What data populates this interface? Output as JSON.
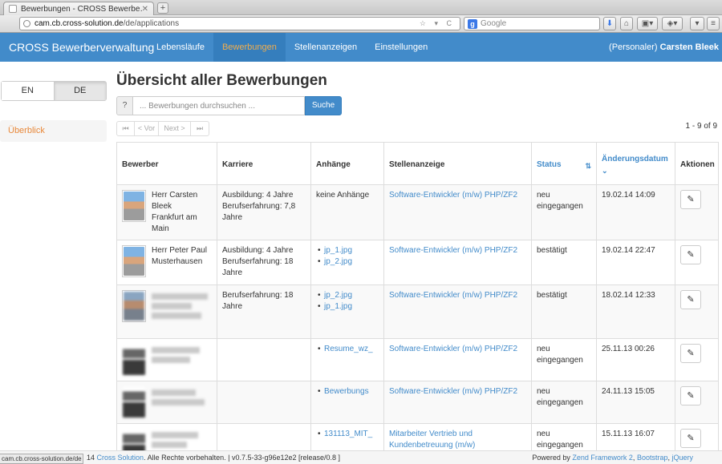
{
  "browser": {
    "tab_title": "Bewerbungen - CROSS Bewerbe…",
    "url_host": "cam.cb.cross-solution.de",
    "url_path": "/de/applications",
    "search_placeholder": "Google",
    "status_url": "cam.cb.cross-solution.de/de"
  },
  "app": {
    "brand": "CROSS Bewerberverwaltung",
    "nav": [
      "Lebensläufe",
      "Bewerbungen",
      "Stellenanzeigen",
      "Einstellungen"
    ],
    "active_nav": "Bewerbungen",
    "user_role": "(Personaler)",
    "user_name": "Carsten Bleek"
  },
  "sidebar": {
    "languages": [
      "EN",
      "DE"
    ],
    "active_language": "DE",
    "overview": "Überblick"
  },
  "main": {
    "title": "Übersicht aller Bewerbungen",
    "search_addon": "?",
    "search_placeholder": "... Bewerbungen durchsuchen ...",
    "search_button": "Suche",
    "pager": {
      "first": "⏮",
      "prev": "< Vor",
      "next": "Next >",
      "last": "⏭"
    },
    "result_count": "1 - 9 of 9"
  },
  "table": {
    "headers": [
      "Bewerber",
      "Karriere",
      "Anhänge",
      "Stellenanzeige",
      "Status",
      "Änderungsdatum",
      "Aktionen"
    ],
    "rows": [
      {
        "name": "Herr Carsten Bleek",
        "city": "Frankfurt am Main",
        "career": "Ausbildung: 4 Jahre Berufserfahrung: 7,8 Jahre",
        "attachments_text": "keine Anhänge",
        "attachments": [],
        "job": "Software-Entwickler (m/w) PHP/ZF2",
        "status": "neu eingegangen",
        "date": "19.02.14 14:09"
      },
      {
        "name": "Herr Peter Paul Musterhausen",
        "city": "",
        "career": "Ausbildung: 4 Jahre Berufserfahrung: 18 Jahre",
        "attachments_text": "",
        "attachments": [
          "jp_1.jpg",
          "jp_2.jpg"
        ],
        "job": "Software-Entwickler (m/w) PHP/ZF2",
        "status": "bestätigt",
        "date": "19.02.14 22:47"
      },
      {
        "name": "",
        "city": "",
        "career": "Berufserfahrung: 18 Jahre",
        "attachments_text": "",
        "attachments": [
          "jp_2.jpg",
          "jp_1.jpg"
        ],
        "job": "Software-Entwickler (m/w) PHP/ZF2",
        "status": "bestätigt",
        "date": "18.02.14 12:33"
      },
      {
        "name": "",
        "city": "",
        "career": "",
        "attachments_text": "",
        "attachments": [
          "Resume_wz_"
        ],
        "job": "Software-Entwickler (m/w) PHP/ZF2",
        "status": "neu eingegangen",
        "date": "25.11.13 00:26"
      },
      {
        "name": "",
        "city": "",
        "career": "",
        "attachments_text": "",
        "attachments": [
          "Bewerbungs"
        ],
        "job": "Software-Entwickler (m/w) PHP/ZF2",
        "status": "neu eingegangen",
        "date": "24.11.13 15:05"
      },
      {
        "name": "",
        "city": "",
        "career": "",
        "attachments_text": "",
        "attachments": [
          "131113_MIT_"
        ],
        "job": "Mitarbeiter Vertrieb und Kundenbetreuung (m/w)",
        "status": "neu eingegangen",
        "date": "15.11.13 16:07"
      }
    ]
  },
  "footer": {
    "copyright_prefix": "14",
    "company": "Cross Solution",
    "rights": ". Alle Rechte vorbehalten. | v0.7.5-33-g96e12e2 [release/0.8 ]",
    "powered_by": "Powered by",
    "links": [
      "Zend Framework 2",
      "Bootstrap",
      "jQuery"
    ]
  },
  "colors": {
    "primary": "#428bca",
    "active_nav_text": "#f0ad4e",
    "sidebar_active": "#e8883a"
  }
}
